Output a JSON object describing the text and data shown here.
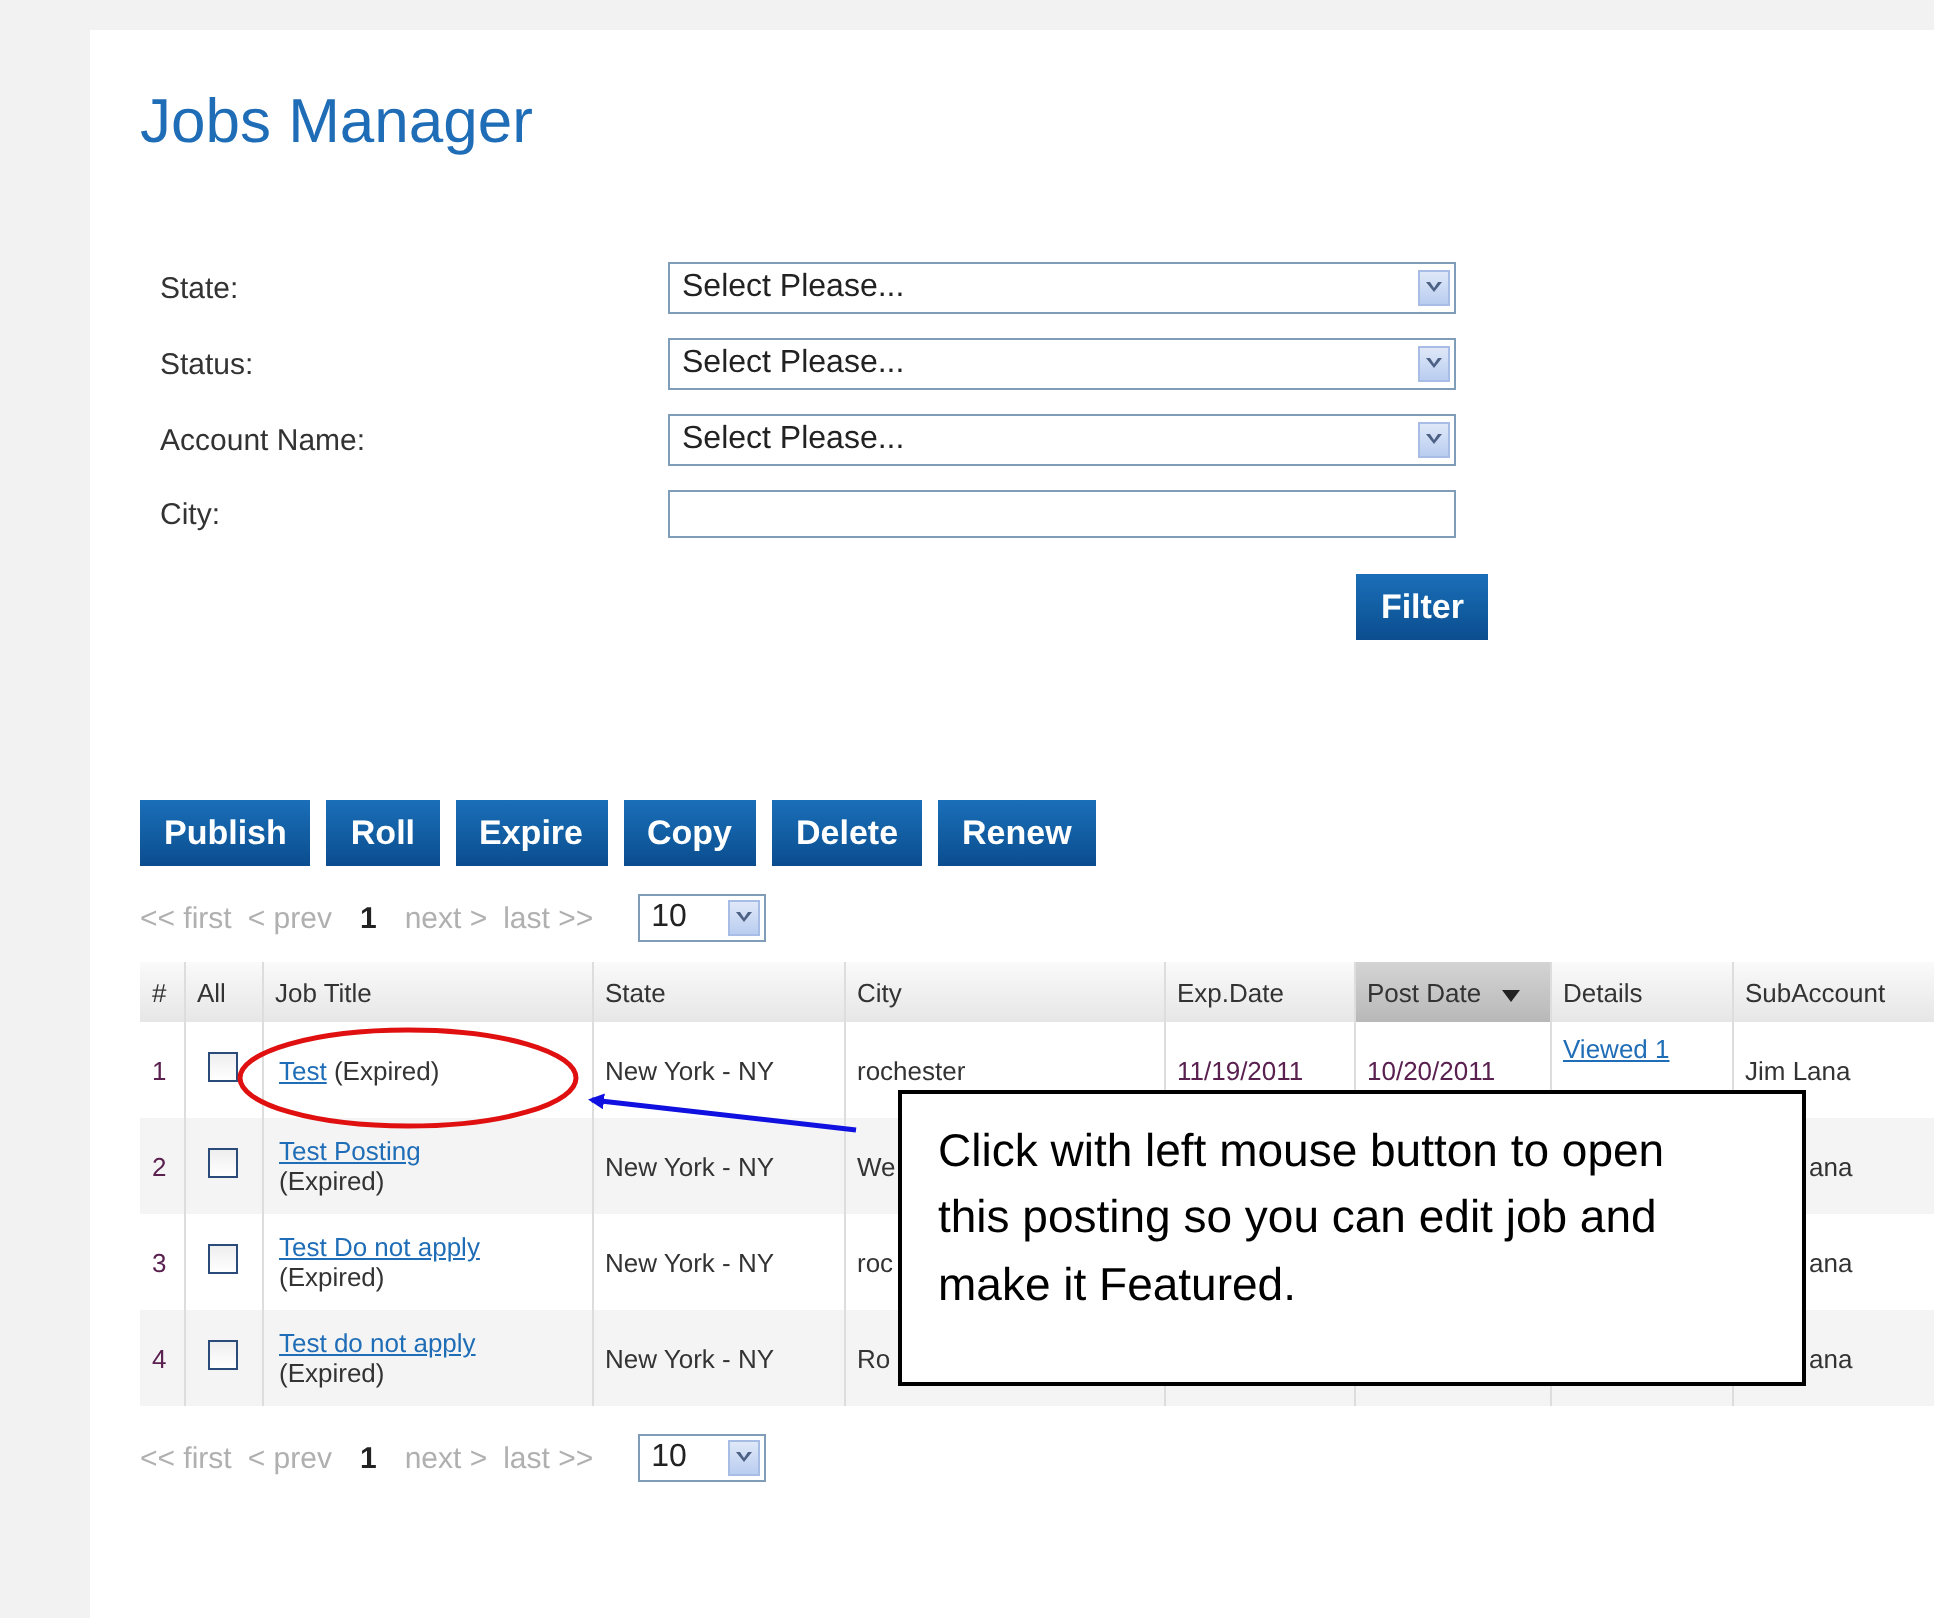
{
  "title": "Jobs Manager",
  "filters": [
    {
      "label": "State:",
      "kind": "select",
      "value": "Select Please..."
    },
    {
      "label": "Status:",
      "kind": "select",
      "value": "Select Please..."
    },
    {
      "label": "Account Name:",
      "kind": "select",
      "value": "Select Please..."
    },
    {
      "label": "City:",
      "kind": "text"
    }
  ],
  "filter_button": "Filter",
  "actions": [
    "Publish",
    "Roll",
    "Expire",
    "Copy",
    "Delete",
    "Renew"
  ],
  "pagination_top": {
    "first": "<< first",
    "prev": "< prev",
    "page": "1",
    "next": "next >",
    "last": "last >>",
    "per_page": "10"
  },
  "table": {
    "columns": [
      {
        "label": "#",
        "sorted": false
      },
      {
        "label": "All",
        "sorted": false
      },
      {
        "label": "Job Title",
        "sorted": false
      },
      {
        "label": "State",
        "sorted": false
      },
      {
        "label": "City",
        "sorted": false
      },
      {
        "label": "Exp.Date",
        "sorted": false
      },
      {
        "label": "Post Date",
        "sorted": true
      },
      {
        "label": "Details",
        "sorted": false
      },
      {
        "label": "SubAccount",
        "sorted": false
      }
    ],
    "rows": [
      {
        "num": "1",
        "checked": false,
        "title": "Test",
        "status": "(Expired)",
        "state": "New York - NY",
        "city": "rochester",
        "exp_date": "11/19/2011",
        "post_date": "10/20/2011",
        "details": "Viewed 1",
        "subaccount": "Jim Lana"
      },
      {
        "num": "2",
        "checked": false,
        "title": "Test Posting",
        "status": "(Expired)",
        "state": "New York - NY",
        "city": "We",
        "subaccount": "ana"
      },
      {
        "num": "3",
        "checked": false,
        "title": "Test Do not apply",
        "status": "(Expired)",
        "state": "New York - NY",
        "city": "roc",
        "subaccount": "ana"
      },
      {
        "num": "4",
        "checked": false,
        "title": "Test do not apply",
        "status": "(Expired)",
        "state": "New York - NY",
        "city": "Ro",
        "subaccount": "ana"
      }
    ]
  },
  "pagination_bottom": {
    "first": "<< first",
    "prev": "< prev",
    "page": "1",
    "next": "next >",
    "last": "last >>",
    "per_page": "10"
  },
  "callout": {
    "text": "Click with left mouse button to open this posting so you can edit job and make it Featured."
  }
}
